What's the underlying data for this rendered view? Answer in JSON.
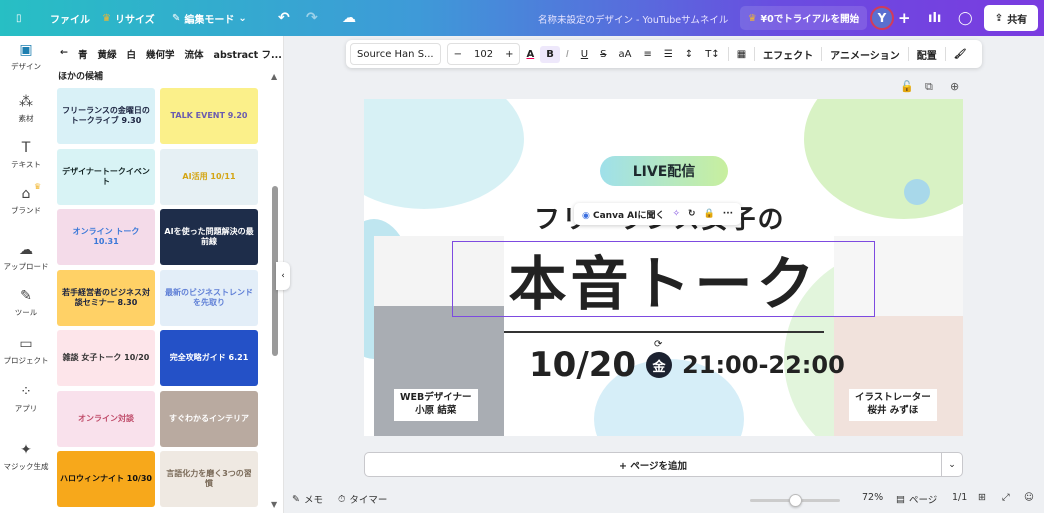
{
  "topbar": {
    "file": "ファイル",
    "resize": "リサイズ",
    "edit_mode": "編集モード",
    "doc_title": "名称未設定のデザイン - YouTubeサムネイル",
    "trial": "¥0でトライアルを開始",
    "avatar": "Y",
    "share": "共有"
  },
  "rail": [
    {
      "label": "デザイン",
      "icon": "design-icon"
    },
    {
      "label": "素材",
      "icon": "elements-icon"
    },
    {
      "label": "テキスト",
      "icon": "text-icon"
    },
    {
      "label": "ブランド",
      "icon": "brand-icon"
    },
    {
      "label": "アップロード",
      "icon": "upload-icon"
    },
    {
      "label": "ツール",
      "icon": "tools-icon"
    },
    {
      "label": "プロジェクト",
      "icon": "folder-icon"
    },
    {
      "label": "アプリ",
      "icon": "apps-icon"
    },
    {
      "label": "マジック生成",
      "icon": "magic-icon"
    }
  ],
  "panel": {
    "chips": [
      "青",
      "黄緑",
      "白",
      "幾何学",
      "流体",
      "abstract フ..."
    ],
    "section_title": "ほかの候補",
    "thumbs": [
      {
        "text": "フリーランスの金曜日のトークライブ 9.30",
        "bg": "#d9f1f7",
        "fg": "#1b2340"
      },
      {
        "text": "TALK EVENT 9.20",
        "bg": "#fbf08a",
        "fg": "#6a5bb0"
      },
      {
        "text": "デザイナートークイベント",
        "bg": "#d8f3f5",
        "fg": "#122"
      },
      {
        "text": "AI活用 10/11",
        "bg": "#e6f0f4",
        "fg": "#d4a514"
      },
      {
        "text": "オンライン トーク 10.31",
        "bg": "#f4dbe9",
        "fg": "#3a78d8"
      },
      {
        "text": "AIを使った問題解決の最前線",
        "bg": "#1e2d4a",
        "fg": "#fff"
      },
      {
        "text": "若手経営者のビジネス対談セミナー 8.30",
        "bg": "#ffd166",
        "fg": "#1b2340"
      },
      {
        "text": "最新のビジネストレンドを先取り",
        "bg": "#e3eef8",
        "fg": "#5f7fd6"
      },
      {
        "text": "雑談 女子トーク 10/20",
        "bg": "#fde5ea",
        "fg": "#333"
      },
      {
        "text": "完全攻略ガイド 6.21",
        "bg": "#2451c7",
        "fg": "#fff"
      },
      {
        "text": "オンライン対談",
        "bg": "#f9e1ec",
        "fg": "#c04c6a"
      },
      {
        "text": "すぐわかるインテリア",
        "bg": "#b9aaa0",
        "fg": "#fff"
      },
      {
        "text": "ハロウィンナイト 10/30",
        "bg": "#f7a81b",
        "fg": "#111"
      },
      {
        "text": "言語化力を磨く3つの習慣",
        "bg": "#efe9e2",
        "fg": "#7a6a58"
      }
    ]
  },
  "text_toolbar": {
    "font": "Source Han S...",
    "size": "102",
    "effects": "エフェクト",
    "animation": "アニメーション",
    "position": "配置"
  },
  "design": {
    "live": "LIVE配信",
    "subtitle": "フリーランス女子の",
    "main": "本音トーク",
    "date": "10/20",
    "weekday": "金",
    "time": "21:00-22:00",
    "left_person": {
      "role": "WEBデザイナー",
      "name": "小原 結菜"
    },
    "right_person": {
      "role": "イラストレーター",
      "name": "桜井 みずほ"
    },
    "ai_button": "Canva AIに聞く"
  },
  "add_page": "+ ページを追加",
  "bottom": {
    "notes": "メモ",
    "timer": "タイマー",
    "zoom": "72%",
    "zoom_fraction": 0.5,
    "pages": "ページ",
    "page_count": "1/1"
  }
}
